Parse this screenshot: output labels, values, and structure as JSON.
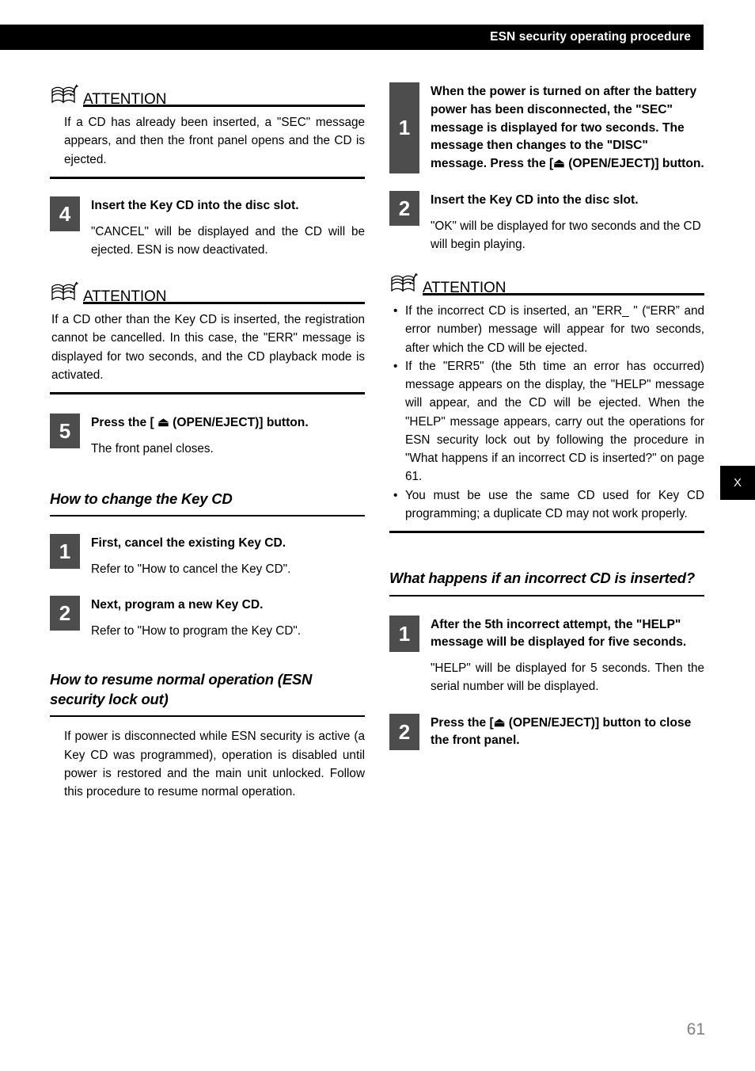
{
  "header": {
    "title": "ESN security operating procedure",
    "bar_color": "#000000",
    "text_color": "#ffffff"
  },
  "side_tab": {
    "label": "X",
    "background": "#000000",
    "text_color": "#ffffff"
  },
  "footer": {
    "page_number": "61",
    "color": "#808080"
  },
  "style": {
    "badge_color": "#4d4d4d",
    "rule_color": "#000000"
  },
  "left_column": {
    "attention_1": {
      "label": "ATTENTION",
      "icon": "open-book-icon",
      "body": "If a CD has already been inserted, a \"SEC\" message appears, and then the front panel opens and the CD is ejected."
    },
    "step_4": {
      "number": "4",
      "title": "Insert the Key CD into the disc slot.",
      "desc": "\"CANCEL\" will be displayed and the CD will be ejected. ESN is now deactivated."
    },
    "attention_2": {
      "label": "ATTENTION",
      "icon": "open-book-icon",
      "body": "If a CD other than the Key CD is inserted, the registration cannot be cancelled. In this case, the \"ERR\" message is displayed for two seconds, and the CD playback mode is activated."
    },
    "step_5": {
      "number": "5",
      "title": "Press the [ ⏏ (OPEN/EJECT)] button.",
      "desc": "The front panel closes."
    },
    "section_change_key_cd": {
      "title": "How to change the Key CD",
      "step_1": {
        "number": "1",
        "title": "First, cancel the existing Key CD.",
        "desc": "Refer to \"How to cancel the Key CD\"."
      },
      "step_2": {
        "number": "2",
        "title": "Next, program a new Key CD.",
        "desc": "Refer to \"How to program the Key CD\"."
      }
    },
    "section_resume_normal": {
      "title": "How to resume normal operation (ESN security lock out)",
      "intro": "If power is disconnected while ESN security is active (a Key CD was programmed), operation is disabled until power is restored and the main unit unlocked. Follow this procedure to resume normal operation."
    }
  },
  "right_column": {
    "step_1": {
      "number": "1",
      "title": "When the power is turned on after the battery power has been disconnected, the \"SEC\" message is displayed for two seconds. The message then changes to the \"DISC\" message. Press the [⏏ (OPEN/EJECT)] button."
    },
    "step_2": {
      "number": "2",
      "title": "Insert the Key CD into the disc slot.",
      "desc": "\"OK\" will be displayed for two seconds and the CD will begin playing."
    },
    "attention": {
      "label": "ATTENTION",
      "icon": "open-book-icon",
      "bullets": [
        "If the incorrect CD is inserted, an \"ERR_ \" (“ERR” and error number) message will appear for two seconds, after which the CD will be ejected.",
        "If the \"ERR5\" (the 5th time an error has occurred) message appears on the display, the \"HELP\" message will appear, and the CD will be ejected. When the \"HELP\" message appears, carry out the operations for ESN security lock out by following the procedure in \"What happens if an incorrect CD is inserted?\" on page 61.",
        "You must be use the same CD used for Key CD programming; a duplicate CD may not work properly."
      ]
    },
    "section_incorrect_cd": {
      "title": "What happens if an incorrect CD is inserted?",
      "step_1": {
        "number": "1",
        "title": "After the 5th incorrect attempt, the \"HELP\" message will be displayed for five seconds.",
        "desc": "\"HELP\" will be displayed for 5 seconds. Then the serial number will be displayed."
      },
      "step_2": {
        "number": "2",
        "title": "Press the [⏏ (OPEN/EJECT)] button to close the front panel."
      }
    }
  }
}
